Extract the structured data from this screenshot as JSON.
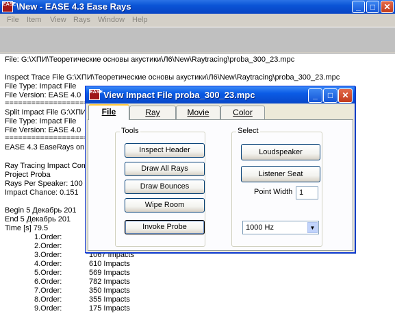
{
  "window": {
    "title": "\\New - EASE 4.3 Ease Rays",
    "icon_text": "EASE"
  },
  "menu": [
    "File",
    "Item",
    "View",
    "Rays",
    "Window",
    "Help"
  ],
  "report": {
    "lines": [
      "File: G:\\ХПИ\\Теоретические основы акустики\\Л6\\New\\Raytracing\\proba_300_23.mpc",
      "",
      "Inspect Trace File G:\\ХПИ\\Теоретические основы акустики\\Л6\\New\\Raytracing\\proba_300_23.mpc",
      "File Type: Impact File",
      "File Version: EASE 4.0",
      "==================================",
      "Split Impact File G:\\ХПИ",
      "File Type: Impact File",
      "File Version: EASE 4.0",
      "==================================",
      "EASE 4.3 EaseRays on",
      "",
      "Ray Tracing Impact Com",
      "Project  Proba",
      "Rays Per Speaker: 100",
      "Impact Chance:  0.151",
      "",
      "Begin    5 Декабрь 201",
      "End      5 Декабрь 201",
      "Time [s]  79.5"
    ],
    "orders": [
      {
        "label": "1.Order:",
        "value": ""
      },
      {
        "label": "2.Order:",
        "value": ""
      },
      {
        "label": "3.Order:",
        "value": "1067 Impacts"
      },
      {
        "label": "4.Order:",
        "value": "610 Impacts"
      },
      {
        "label": "5.Order:",
        "value": "569 Impacts"
      },
      {
        "label": "6.Order:",
        "value": "782 Impacts"
      },
      {
        "label": "7.Order:",
        "value": "350 Impacts"
      },
      {
        "label": "8.Order:",
        "value": "355 Impacts"
      },
      {
        "label": "9.Order:",
        "value": "175 Impacts"
      }
    ]
  },
  "dialog": {
    "title": "View Impact File proba_300_23.mpc",
    "tabs": [
      "File",
      "Ray",
      "Movie",
      "Color"
    ],
    "active_tab": "File",
    "tools": {
      "label": "Tools",
      "buttons": [
        "Inspect Header",
        "Draw All Rays",
        "Draw Bounces",
        "Wipe Room",
        "Invoke Probe"
      ]
    },
    "select": {
      "label": "Select",
      "loudspeaker": "Loudspeaker",
      "listener_seat": "Listener Seat",
      "point_width_label": "Point Width",
      "point_width_value": "1",
      "frequency": "1000 Hz"
    }
  },
  "colors": {
    "titlebar": "#0a54d6",
    "dialog_bg": "#ece9d8"
  }
}
